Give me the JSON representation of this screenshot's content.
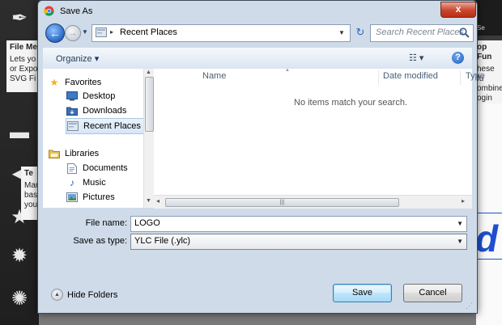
{
  "background_app": {
    "panel1": {
      "title": "File Me",
      "text": "Lets yo or Expo SVG Fi"
    },
    "panel2": {
      "title": "Te",
      "text": "Mar bas you"
    },
    "panel3": {
      "title": "op Fun",
      "text": "hese fu ombine ogin to ore..."
    },
    "toolbar_label": "Se",
    "canvas_glyph": "d"
  },
  "dialog": {
    "title": "Save As",
    "close_glyph": "x",
    "address": {
      "path": "Recent Places",
      "separator": "▸"
    },
    "search": {
      "placeholder": "Search Recent Places"
    },
    "command_bar": {
      "organize_label": "Organize ▾",
      "view_label": "☷ ▾",
      "help_label": "?"
    },
    "navigation": {
      "favorites": {
        "label": "Favorites",
        "items": [
          "Desktop",
          "Downloads",
          "Recent Places"
        ]
      },
      "libraries": {
        "label": "Libraries",
        "items": [
          "Documents",
          "Music",
          "Pictures"
        ]
      },
      "selected": "Recent Places"
    },
    "columns": [
      "Name",
      "Date modified",
      "Type"
    ],
    "empty_message": "No items match your search.",
    "file_name": {
      "label": "File name:",
      "value": "LOGO"
    },
    "save_as_type": {
      "label": "Save as type:",
      "value": "YLC File (.ylc)"
    },
    "hide_folders_label": "Hide Folders",
    "save_label": "Save",
    "cancel_label": "Cancel"
  },
  "colors": {
    "accent": "#2a67c4",
    "close": "#c9442c",
    "selection": "#d6e6f8"
  }
}
